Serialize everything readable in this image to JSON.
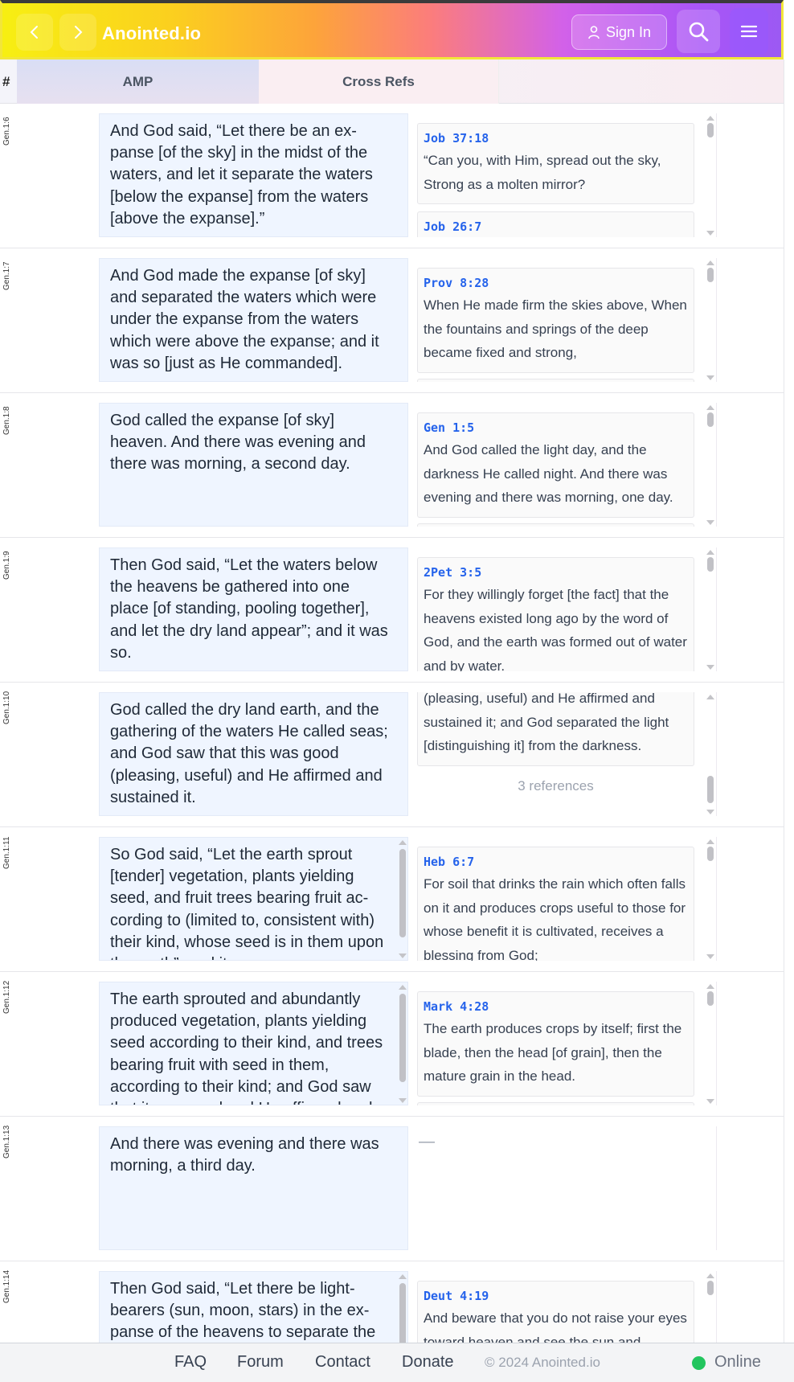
{
  "header": {
    "logo": "Anointed.io",
    "sign_in": "Sign In"
  },
  "columns": {
    "hash": "#",
    "amp": "AMP",
    "cross_refs": "Cross Refs"
  },
  "rows": [
    {
      "ref": "Gen.1:6",
      "verse": "And God said, “Let there be an ex-panse [of the sky] in the midst of the waters, and let it separate the waters [below the expanse] from the waters [above the expanse].”",
      "xrefs": [
        {
          "ref": "Job 37:18",
          "text": "“Can you, with Him, spread out the sky, Strong as a molten mirror?"
        },
        {
          "ref": "Job 26:7",
          "text": ""
        }
      ]
    },
    {
      "ref": "Gen.1:7",
      "verse": "And God made the expanse [of sky] and separated the waters which were under the expanse from the waters which were above the expanse; and it was so [just as He commanded].",
      "xrefs": [
        {
          "ref": "Prov 8:28",
          "text": "When He made firm the skies above, When the fountains and springs of the deep became fixed and strong,"
        }
      ]
    },
    {
      "ref": "Gen.1:8",
      "verse": "God called the expanse [of sky] heaven. And there was evening and there was morning, a second day.",
      "xrefs": [
        {
          "ref": "Gen 1:5",
          "text": "And God called the light day, and the darkness He called night. And there was evening and there was morning, one day."
        }
      ]
    },
    {
      "ref": "Gen.1:9",
      "verse": "Then God said, “Let the waters below the heavens be gathered into one place [of standing, pooling together], and let the dry land appear”; and it was so.",
      "xrefs": [
        {
          "ref": "2Pet 3:5",
          "text": "For they willingly forget [the fact] that the heavens existed long ago by the word of God, and the earth was formed out of water and by water."
        }
      ]
    },
    {
      "ref": "Gen.1:10",
      "verse": "God called the dry land earth, and the gathering of the waters He called seas; and God saw that this was good (pleasing, useful) and He affirmed and sustained it.",
      "xrefs": [
        {
          "ref": "",
          "text": "(pleasing, useful) and He affirmed and sustained it; and God separated the light [distinguishing it] from the darkness."
        }
      ],
      "count": "3 references"
    },
    {
      "ref": "Gen.1:11",
      "verse": "So God said, “Let the earth sprout [tender] vegetation, plants yielding seed, and fruit trees bearing fruit ac-cording to (limited to, consistent with) their kind, whose seed is in them upon the earth”; and it was so.",
      "xrefs": [
        {
          "ref": "Heb 6:7",
          "text": "For soil that drinks the rain which often falls on it and produces crops useful to those for whose benefit it is cultivated, receives a blessing from God;"
        }
      ]
    },
    {
      "ref": "Gen.1:12",
      "verse": "The earth sprouted and abundantly produced vegetation, plants yielding seed according to their kind, and trees bearing fruit with seed in them, according to their kind; and God saw that it was good and He affirmed and sustained it.",
      "xrefs": [
        {
          "ref": "Mark 4:28",
          "text": "The earth produces crops by itself; first the blade, then the head [of grain], then the mature grain in the head."
        }
      ]
    },
    {
      "ref": "Gen.1:13",
      "verse": "And there was evening and there was morning, a third day.",
      "xrefs": [],
      "empty": "—"
    },
    {
      "ref": "Gen.1:14",
      "verse": "Then God said, “Let there be light-bearers (sun, moon, stars) in the ex-panse of the heavens to separate the day from the night,",
      "xrefs": [
        {
          "ref": "Deut 4:19",
          "text": "And beware that you do not raise your eyes toward heaven and see the sun and"
        }
      ]
    }
  ],
  "footer": {
    "faq": "FAQ",
    "forum": "Forum",
    "contact": "Contact",
    "donate": "Donate",
    "copyright": "© 2024 Anointed.io",
    "status": "Online"
  },
  "colors": {
    "accent_blue": "#2563eb",
    "online_green": "#22c55e",
    "verse_bg": "#eff5ff"
  }
}
